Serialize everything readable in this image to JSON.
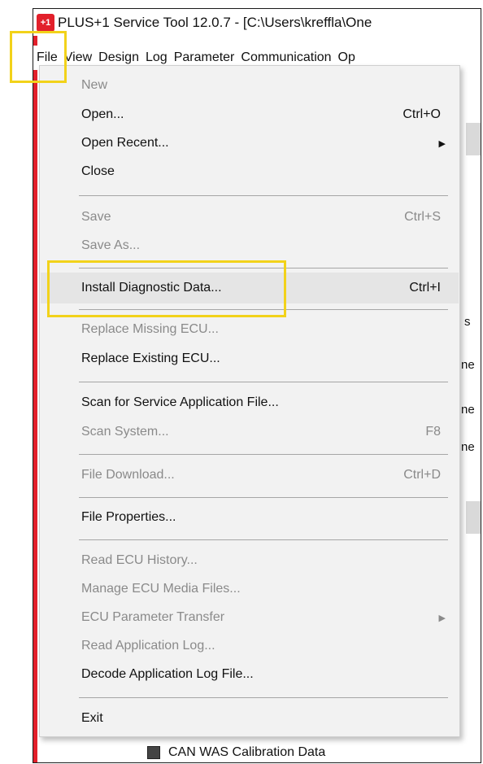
{
  "window": {
    "title": "PLUS+1 Service Tool 12.0.7 - [C:\\Users\\kreffla\\One",
    "icon": "plus1-logo-icon"
  },
  "menubar": [
    "File",
    "View",
    "Design",
    "Log",
    "Parameter",
    "Communication",
    "Op"
  ],
  "menu": {
    "items": [
      {
        "label": "New",
        "shortcut": "",
        "disabled": true
      },
      {
        "label": "Open...",
        "shortcut": "Ctrl+O",
        "disabled": false
      },
      {
        "label": "Open Recent...",
        "shortcut": "",
        "disabled": false,
        "submenu": true
      },
      {
        "label": "Close",
        "shortcut": "",
        "disabled": false
      },
      {
        "label": "Save",
        "shortcut": "Ctrl+S",
        "disabled": true
      },
      {
        "label": "Save As...",
        "shortcut": "",
        "disabled": true
      },
      {
        "label": "Install Diagnostic Data...",
        "shortcut": "Ctrl+I",
        "disabled": false
      },
      {
        "label": "Replace Missing ECU...",
        "shortcut": "",
        "disabled": true
      },
      {
        "label": "Replace Existing ECU...",
        "shortcut": "",
        "disabled": false
      },
      {
        "label": "Scan for Service Application File...",
        "shortcut": "",
        "disabled": false
      },
      {
        "label": "Scan System...",
        "shortcut": "F8",
        "disabled": true
      },
      {
        "label": "File Download...",
        "shortcut": "Ctrl+D",
        "disabled": true
      },
      {
        "label": "File Properties...",
        "shortcut": "",
        "disabled": false
      },
      {
        "label": "Read ECU History...",
        "shortcut": "",
        "disabled": true
      },
      {
        "label": "Manage ECU Media Files...",
        "shortcut": "",
        "disabled": true
      },
      {
        "label": "ECU Parameter Transfer",
        "shortcut": "",
        "disabled": true,
        "submenu": true
      },
      {
        "label": "Read Application Log...",
        "shortcut": "",
        "disabled": true
      },
      {
        "label": "Decode Application Log File...",
        "shortcut": "",
        "disabled": false
      },
      {
        "label": "Exit",
        "shortcut": "",
        "disabled": false
      }
    ]
  },
  "background": {
    "side_letters": [
      "s",
      "ne",
      "ne",
      "ne"
    ],
    "bottom_item": "CAN WAS Calibration Data"
  },
  "colors": {
    "highlight": "#f2d21a",
    "brand_red": "#e2202b",
    "disabled_text": "#8a8a8a"
  }
}
